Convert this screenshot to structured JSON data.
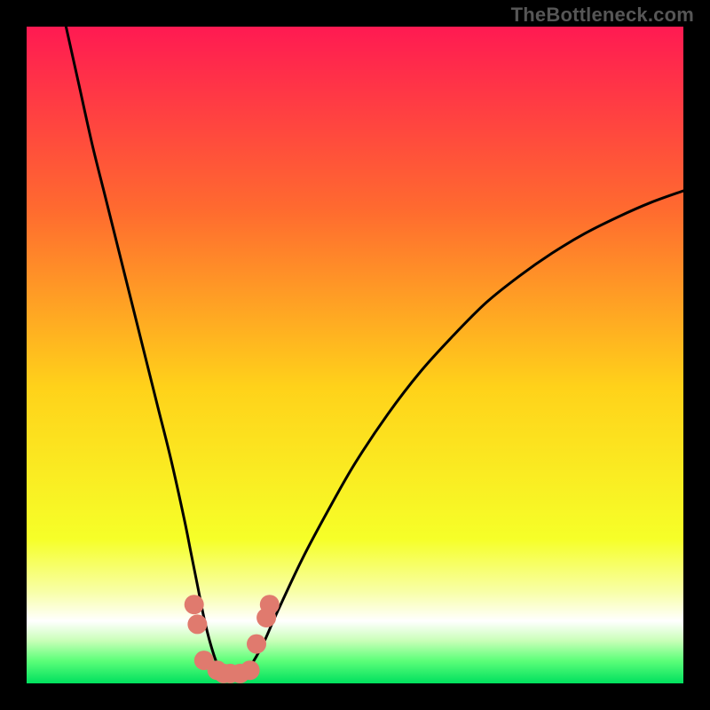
{
  "watermark": "TheBottleneck.com",
  "chart_data": {
    "type": "line",
    "title": "",
    "xlabel": "",
    "ylabel": "",
    "xlim": [
      0,
      100
    ],
    "ylim": [
      0,
      100
    ],
    "grid": false,
    "legend": false,
    "background_gradient": {
      "stops": [
        {
          "offset": 0,
          "color": "#ff1a52"
        },
        {
          "offset": 0.28,
          "color": "#ff6b2f"
        },
        {
          "offset": 0.55,
          "color": "#ffd21a"
        },
        {
          "offset": 0.78,
          "color": "#f6ff28"
        },
        {
          "offset": 0.86,
          "color": "#f8ffa6"
        },
        {
          "offset": 0.905,
          "color": "#ffffff"
        },
        {
          "offset": 0.935,
          "color": "#c9ffb8"
        },
        {
          "offset": 0.965,
          "color": "#5eff7a"
        },
        {
          "offset": 1.0,
          "color": "#00e05e"
        }
      ]
    },
    "series": [
      {
        "name": "bottleneck-curve",
        "color": "#000000",
        "x": [
          6.0,
          8.0,
          10.0,
          12.0,
          14.0,
          16.0,
          18.0,
          20.0,
          22.0,
          24.0,
          25.0,
          26.0,
          27.0,
          28.0,
          29.0,
          30.0,
          31.0,
          32.0,
          33.0,
          34.0,
          36.0,
          38.0,
          42.0,
          46.0,
          50.0,
          55.0,
          60.0,
          65.0,
          70.0,
          75.0,
          80.0,
          85.0,
          90.0,
          95.0,
          100.0
        ],
        "y": [
          100.0,
          91.0,
          82.0,
          74.0,
          66.0,
          58.0,
          50.0,
          42.0,
          34.0,
          25.0,
          20.0,
          15.0,
          10.0,
          6.0,
          3.0,
          1.5,
          1.0,
          1.0,
          1.5,
          2.5,
          6.0,
          10.5,
          19.0,
          26.5,
          33.5,
          41.0,
          47.5,
          53.0,
          58.0,
          62.0,
          65.5,
          68.5,
          71.0,
          73.2,
          75.0
        ]
      },
      {
        "name": "highlight-markers",
        "type": "scatter",
        "color": "#e07a6e",
        "radius": 11,
        "x": [
          25.5,
          26.0,
          27.0,
          29.0,
          30.0,
          31.0,
          32.5,
          34.0,
          35.0,
          36.5,
          37.0
        ],
        "y": [
          12.0,
          9.0,
          3.5,
          2.0,
          1.5,
          1.5,
          1.5,
          2.0,
          6.0,
          10.0,
          12.0
        ]
      }
    ]
  }
}
